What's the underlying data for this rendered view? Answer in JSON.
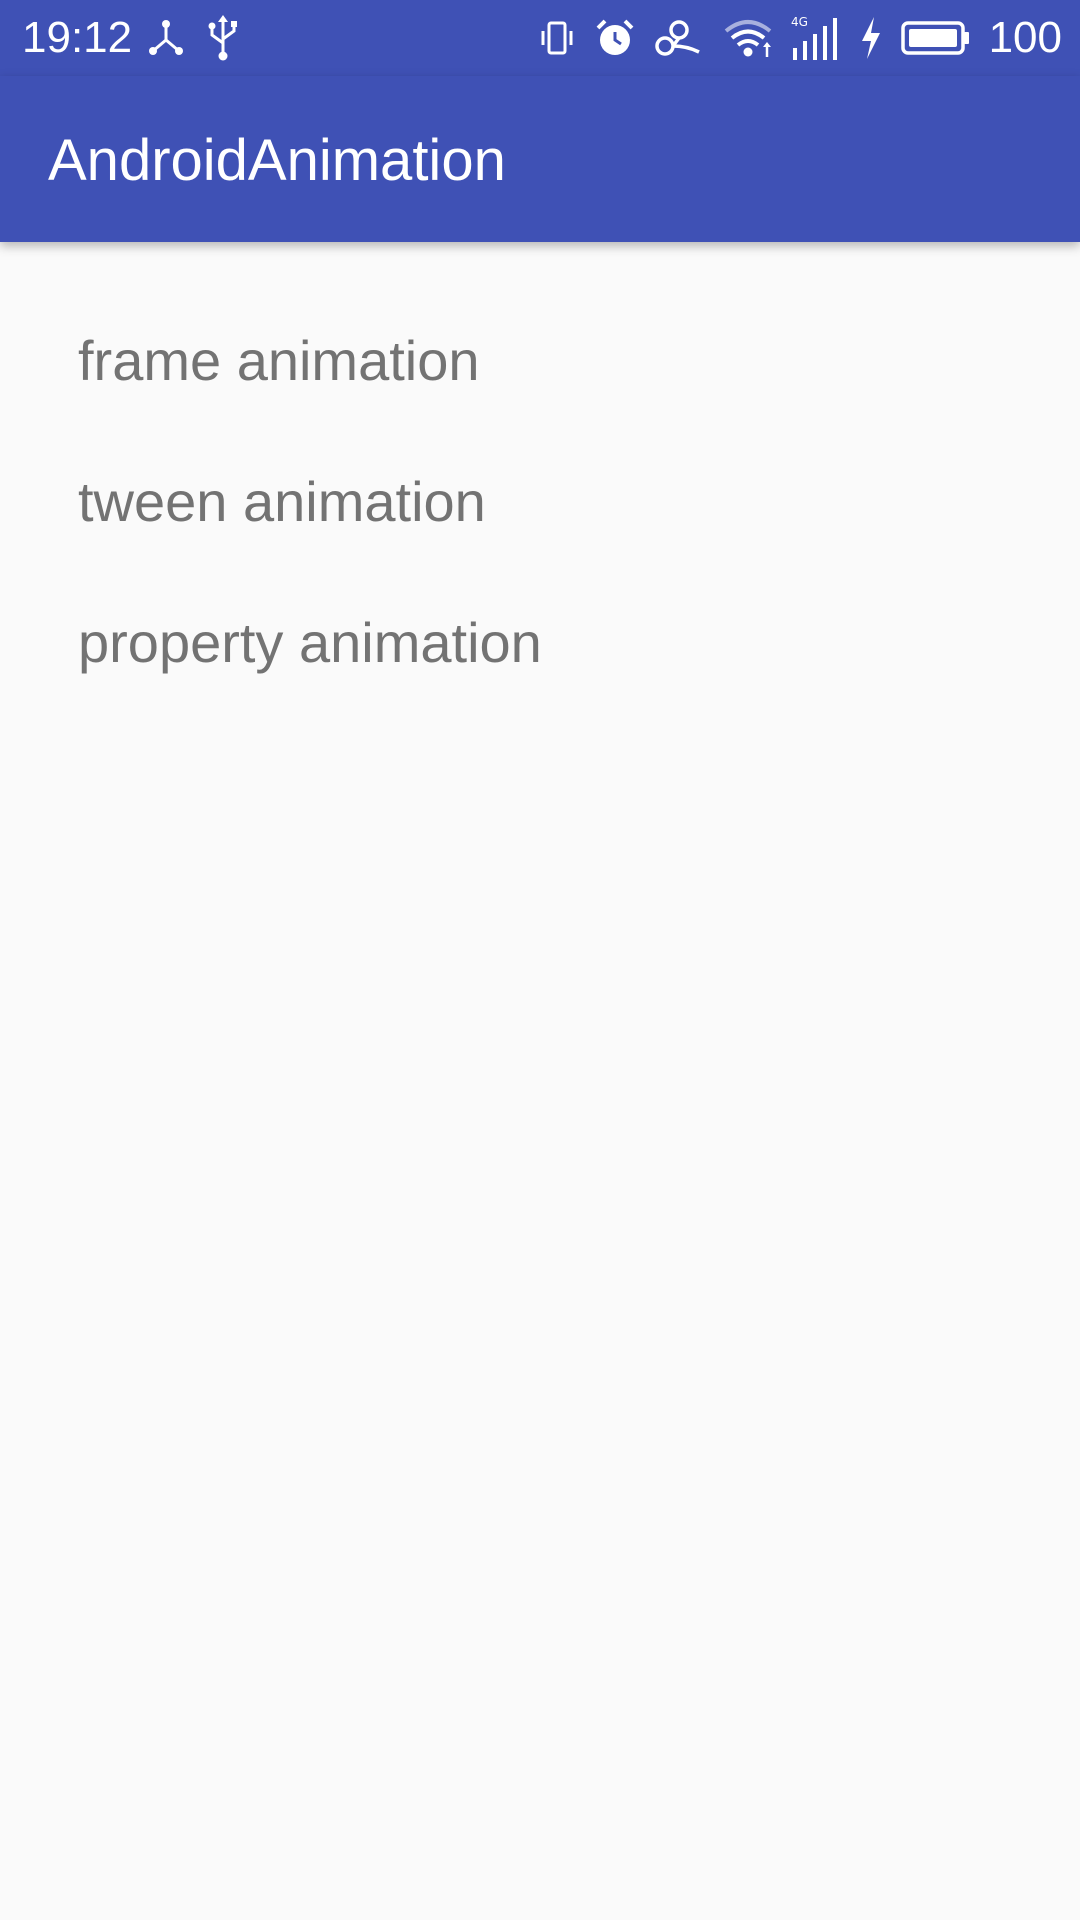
{
  "status_bar": {
    "time": "19:12",
    "battery_percent": "100",
    "left_icons": [
      "usb-tether-icon",
      "usb-icon"
    ],
    "right_icons": [
      "vibrate-icon",
      "alarm-icon",
      "hotspot-icon",
      "wifi-icon",
      "signal-4g-icon",
      "charging-icon",
      "battery-icon"
    ],
    "signal_label": "4G"
  },
  "app_bar": {
    "title": "AndroidAnimation"
  },
  "menu": {
    "items": [
      {
        "label": "frame animation"
      },
      {
        "label": "tween animation"
      },
      {
        "label": "property animation"
      }
    ]
  },
  "colors": {
    "primary": "#3f51b5",
    "background": "#fafafa",
    "item_text": "#737373",
    "on_primary": "#ffffff"
  }
}
